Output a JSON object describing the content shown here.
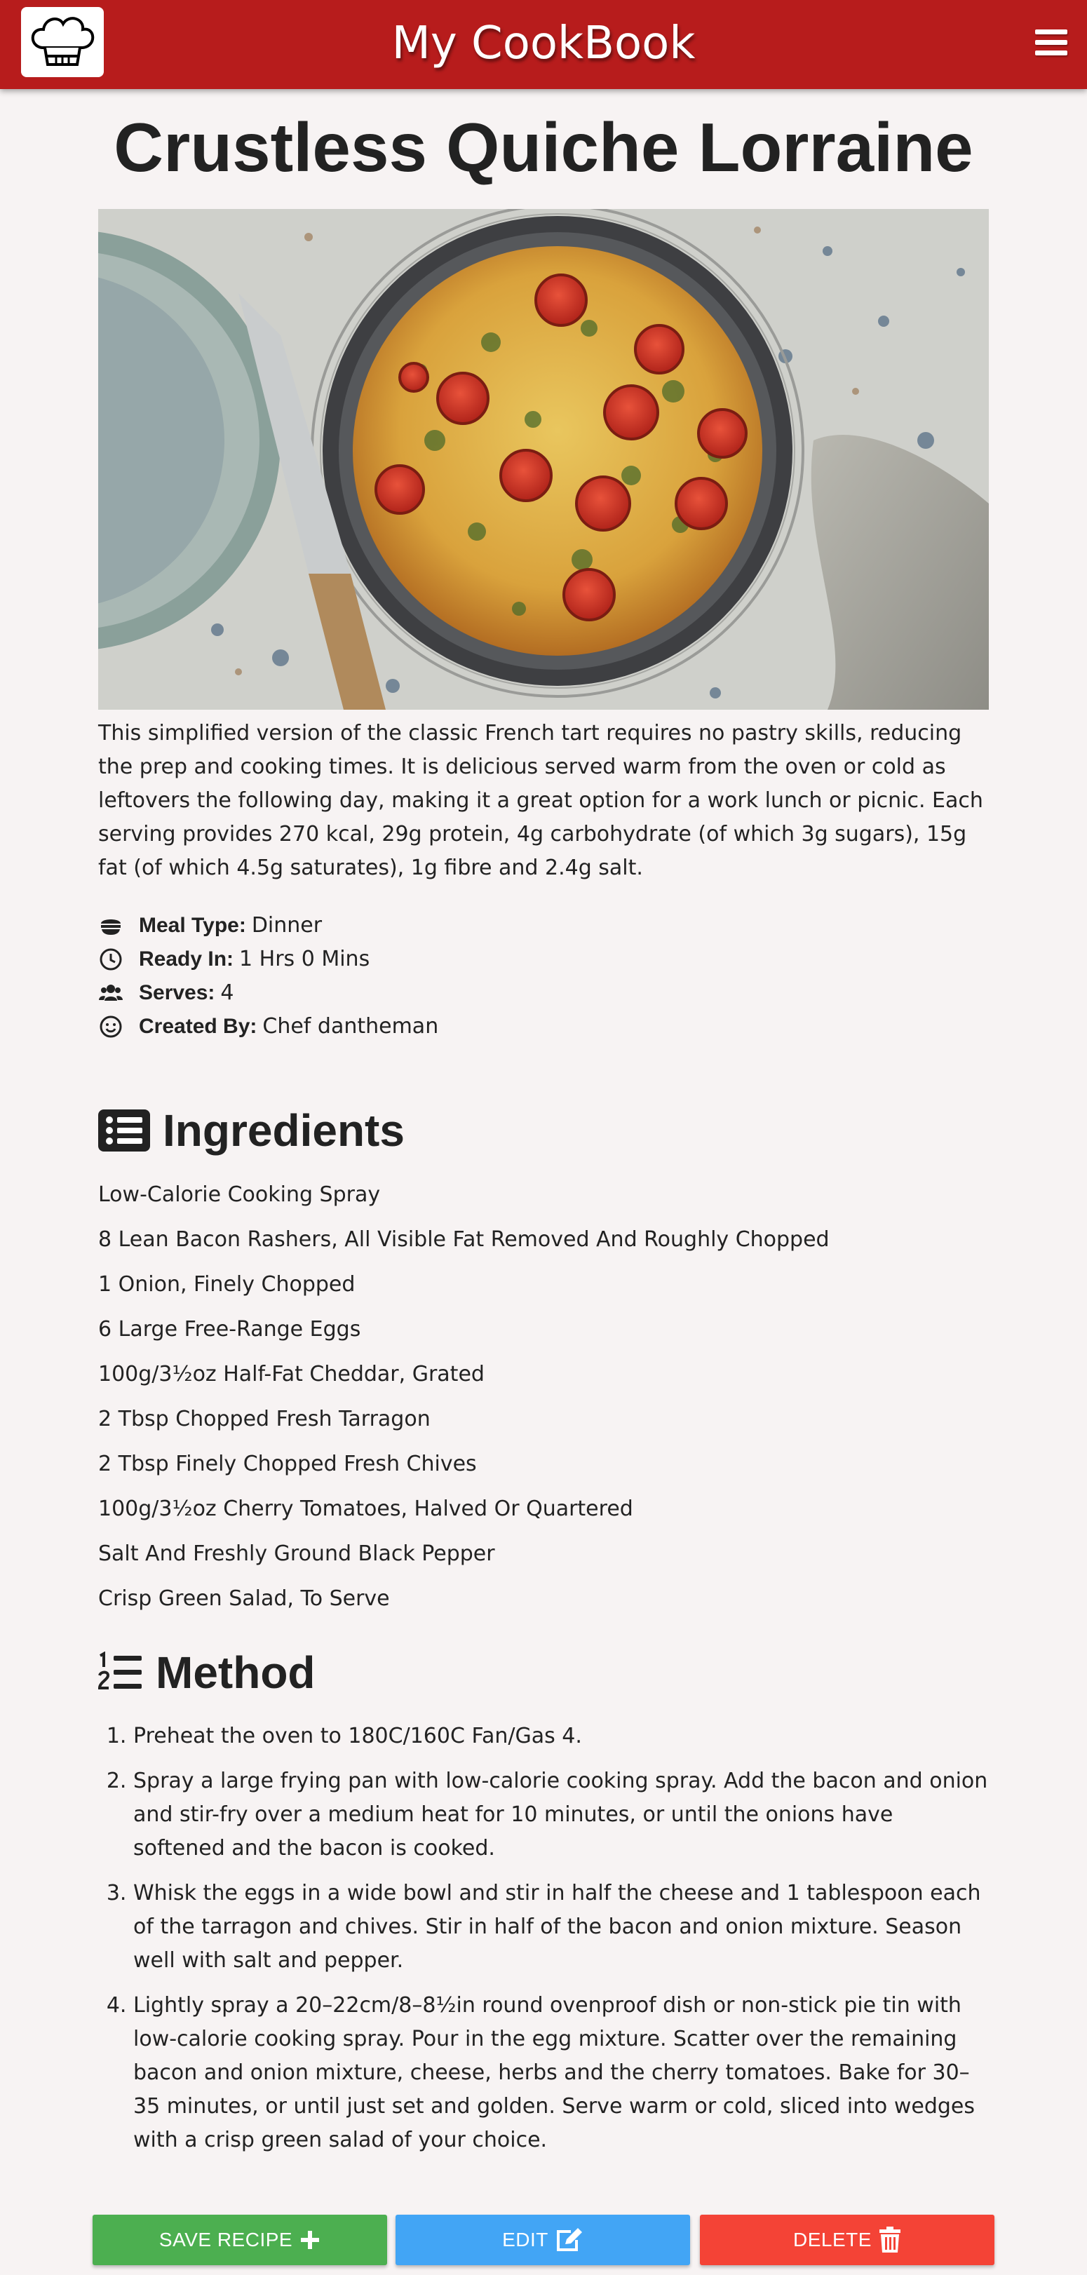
{
  "header": {
    "brand_title": "My CookBook",
    "logo_icon": "chef-hat-icon",
    "menu_icon": "hamburger-menu-icon",
    "colors": {
      "navbar": "#b71c1c",
      "text": "#ffffff"
    }
  },
  "recipe": {
    "title": "Crustless Quiche Lorraine",
    "image_alt": "Crustless Quiche Lorraine",
    "description": "This simplified version of the classic French tart requires no pastry skills, reducing the prep and cooking times. It is delicious served warm from the oven or cold as leftovers the following day, making it a great option for a work lunch or picnic. Each serving provides 270 kcal, 29g protein, 4g carbohydrate (of which 3g sugars), 15g fat (of which 4.5g saturates), 1g fibre and 2.4g salt.",
    "meta": [
      {
        "icon": "meal-bowl-icon",
        "label": "Meal Type:",
        "value": "Dinner"
      },
      {
        "icon": "clock-icon",
        "label": "Ready In:",
        "value": "1 Hrs 0 Mins"
      },
      {
        "icon": "users-icon",
        "label": "Serves:",
        "value": "4"
      },
      {
        "icon": "smile-icon",
        "label": "Created By:",
        "value": "Chef dantheman"
      }
    ]
  },
  "ingredients": {
    "heading": "Ingredients",
    "icon": "list-alt-icon",
    "items": [
      "Low-Calorie Cooking Spray",
      "8 Lean Bacon Rashers, All Visible Fat Removed And Roughly Chopped",
      "1 Onion, Finely Chopped",
      "6 Large Free-Range Eggs",
      "100g/3½oz Half-Fat Cheddar, Grated",
      "2 Tbsp Chopped Fresh Tarragon",
      "2 Tbsp Finely Chopped Fresh Chives",
      "100g/3½oz Cherry Tomatoes, Halved Or Quartered",
      "Salt And Freshly Ground Black Pepper",
      "Crisp Green Salad, To Serve"
    ]
  },
  "method": {
    "heading": "Method",
    "icon": "list-ol-icon",
    "steps": [
      "Preheat the oven to 180C/160C Fan/Gas 4.",
      "Spray a large frying pan with low-calorie cooking spray. Add the bacon and onion and stir-fry over a medium heat for 10 minutes, or until the onions have softened and the bacon is cooked.",
      "Whisk the eggs in a wide bowl and stir in half the cheese and 1 tablespoon each of the tarragon and chives. Stir in half of the bacon and onion mixture. Season well with salt and pepper.",
      "Lightly spray a 20–22cm/8–8½in round ovenproof dish or non-stick pie tin with low-calorie cooking spray. Pour in the egg mixture. Scatter over the remaining bacon and onion mixture, cheese, herbs and the cherry tomatoes. Bake for 30–35 minutes, or until just set and golden. Serve warm or cold, sliced into wedges with a crisp green salad of your choice."
    ]
  },
  "actions": {
    "save_label": "SAVE RECIPE",
    "save_icon": "plus-icon",
    "edit_label": "EDIT",
    "edit_icon": "edit-icon",
    "delete_label": "DELETE",
    "delete_icon": "trash-icon",
    "colors": {
      "save": "#4caf50",
      "edit": "#42a5f5",
      "delete": "#f44336"
    }
  }
}
